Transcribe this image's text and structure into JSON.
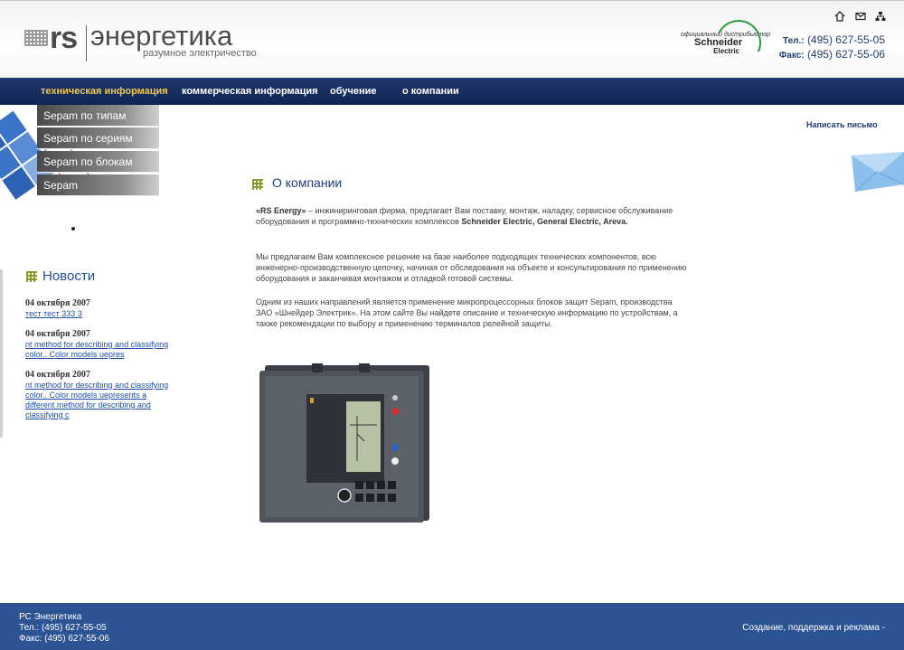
{
  "header": {
    "logo_rs": "rs",
    "logo_name": "энергетика",
    "logo_tagline": "разумное электричество",
    "distributor_text": "официальный дистрибьютор",
    "brand_line1": "Schneider",
    "brand_line2": "Electric",
    "phone_label": "Тел.:",
    "phone": "(495) 627-55-05",
    "fax_label": "Факс:",
    "fax": "(495) 627-55-06"
  },
  "nav": {
    "items": [
      {
        "label": "техническая информация"
      },
      {
        "label": "коммерческая информация"
      },
      {
        "label": "обучение"
      },
      {
        "label": "о компании"
      }
    ]
  },
  "submenu": {
    "items": [
      {
        "label": "Sepam по типам"
      },
      {
        "label": "Sepam по сериям"
      },
      {
        "label": "Sepam по блокам"
      },
      {
        "label": "Sepam"
      }
    ]
  },
  "news": {
    "title": "Новости",
    "items": [
      {
        "date": "04 октября 2007",
        "text": "тест тест 333 3"
      },
      {
        "date": "04 октября 2007",
        "text": "nt method for describing and classifying color.. Color models uepres"
      },
      {
        "date": "04 октября 2007",
        "text": "nt method for describing and classifying color.. Color models uepresents a different method for describing and classifying c"
      }
    ]
  },
  "main": {
    "write_letter": "Написать письмо",
    "title": "О компании",
    "p1_strong": "«RS Energy»",
    "p1_text": " – инжиниринговая фирма, предлагает Вам поставку, монтаж, наладку, сервисное обслуживание оборудования и программно-технических комплексов ",
    "p1_brands": "Schneider Electric, General Electric, Areva.",
    "p2": "Мы предлагаем Вам комплексное решение на базе наиболее подходящих технических компонентов, всю инженерно-производственную цепочку, начиная от обследования на объекте и консультирования по применению оборудования и заканчивая монтажом и отладкой готовой системы.",
    "p3": "Одним из наших направлений является применение микропроцессорных блоков защит Sepam, производства ЗАО «Шнейдер Электрик». На этом сайте Вы найдете описание и техническую информацию по устройствам, а также рекомендации по выбору и применению терминалов релейной защиты."
  },
  "footer": {
    "company": "РС Энергетика",
    "phone": "Тел.: (495) 627-55-05",
    "fax": "Факс: (495) 627-55-06",
    "credit": "Создание, поддержка и реклама -"
  }
}
